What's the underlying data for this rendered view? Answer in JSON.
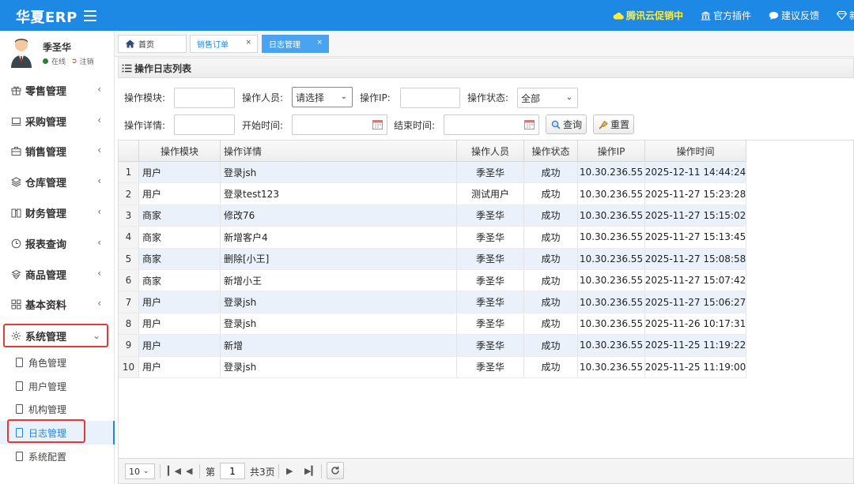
{
  "app": {
    "title": "华夏ERP"
  },
  "header": {
    "links": [
      {
        "label": "腾讯云促销中",
        "icon": "cloud-icon"
      },
      {
        "label": "官方插件",
        "icon": "bank-icon"
      },
      {
        "label": "建议反馈",
        "icon": "chat-icon"
      }
    ],
    "truncated_label": "新"
  },
  "user": {
    "name": "季圣华",
    "status": "在线",
    "logout": "注销"
  },
  "sidebar": {
    "items": [
      {
        "label": "零售管理",
        "icon": "gift-icon"
      },
      {
        "label": "采购管理",
        "icon": "laptop-icon"
      },
      {
        "label": "销售管理",
        "icon": "briefcase-icon"
      },
      {
        "label": "仓库管理",
        "icon": "layers-icon"
      },
      {
        "label": "财务管理",
        "icon": "book-icon"
      },
      {
        "label": "报表查询",
        "icon": "clock-icon"
      },
      {
        "label": "商品管理",
        "icon": "stack-icon"
      },
      {
        "label": "基本资料",
        "icon": "grid-icon"
      },
      {
        "label": "系统管理",
        "icon": "gear-icon"
      }
    ],
    "sub_items": [
      {
        "label": "角色管理"
      },
      {
        "label": "用户管理"
      },
      {
        "label": "机构管理"
      },
      {
        "label": "日志管理"
      },
      {
        "label": "系统配置"
      }
    ]
  },
  "tabs": [
    {
      "label": "首页"
    },
    {
      "label": "销售订单"
    },
    {
      "label": "日志管理"
    }
  ],
  "panel": {
    "title": "操作日志列表"
  },
  "search": {
    "module_label": "操作模块:",
    "operator_label": "操作人员:",
    "operator_value": "请选择",
    "ip_label": "操作IP:",
    "status_label": "操作状态:",
    "status_value": "全部",
    "detail_label": "操作详情:",
    "start_label": "开始时间:",
    "end_label": "结束时间:",
    "query_button": "查询",
    "reset_button": "重置"
  },
  "table": {
    "columns": [
      "操作模块",
      "操作详情",
      "操作人员",
      "操作状态",
      "操作IP",
      "操作时间"
    ],
    "rows": [
      [
        "1",
        "用户",
        "登录jsh",
        "季圣华",
        "成功",
        "10.30.236.55",
        "2025-12-11 14:44:24"
      ],
      [
        "2",
        "用户",
        "登录test123",
        "测试用户",
        "成功",
        "10.30.236.55",
        "2025-11-27 15:23:28"
      ],
      [
        "3",
        "商家",
        "修改76",
        "季圣华",
        "成功",
        "10.30.236.55",
        "2025-11-27 15:15:02"
      ],
      [
        "4",
        "商家",
        "新增客户4",
        "季圣华",
        "成功",
        "10.30.236.55",
        "2025-11-27 15:13:45"
      ],
      [
        "5",
        "商家",
        "删除[小王]",
        "季圣华",
        "成功",
        "10.30.236.55",
        "2025-11-27 15:08:58"
      ],
      [
        "6",
        "商家",
        "新增小王",
        "季圣华",
        "成功",
        "10.30.236.55",
        "2025-11-27 15:07:42"
      ],
      [
        "7",
        "用户",
        "登录jsh",
        "季圣华",
        "成功",
        "10.30.236.55",
        "2025-11-27 15:06:27"
      ],
      [
        "8",
        "用户",
        "登录jsh",
        "季圣华",
        "成功",
        "10.30.236.55",
        "2025-11-26 10:17:31"
      ],
      [
        "9",
        "用户",
        "新增",
        "季圣华",
        "成功",
        "10.30.236.55",
        "2025-11-25 11:19:22"
      ],
      [
        "10",
        "用户",
        "登录jsh",
        "季圣华",
        "成功",
        "10.30.236.55",
        "2025-11-25 11:19:00"
      ]
    ]
  },
  "pager": {
    "page_size": "10",
    "page_label": "第",
    "current_page": "1",
    "total_label": "共3页"
  },
  "colors": {
    "primary": "#1e88e5",
    "highlight": "#e53935",
    "row_alt": "#eaf1fb"
  }
}
